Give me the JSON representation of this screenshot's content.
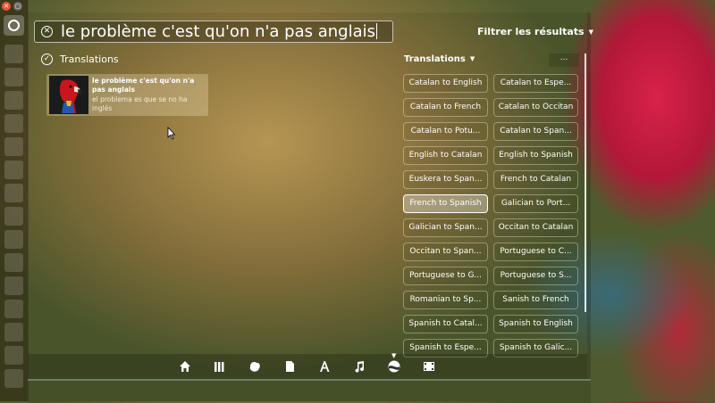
{
  "launcher": {
    "close_icon": "close-icon",
    "maximize_icon": "maximize-icon",
    "home_icon": "ubuntu-logo-icon",
    "items": [
      "app-item",
      "app-item",
      "app-item",
      "app-item",
      "app-item",
      "app-item",
      "app-item",
      "app-item",
      "app-item",
      "app-item",
      "app-item",
      "app-item",
      "app-item",
      "app-item",
      "app-item"
    ]
  },
  "search": {
    "query": "le problème c'est qu'on n'a pas anglais",
    "clear_icon": "clear-icon"
  },
  "filter_toggle": {
    "label": "Filtrer les résultats"
  },
  "results": {
    "category_label": "Translations",
    "category_icon": "check-circle-icon",
    "items": [
      {
        "title": "le problème c'est qu'on n'a pas anglais",
        "subtitle": "el problema es que se no ha inglés",
        "thumbnail": "parrot-icon"
      }
    ]
  },
  "filters": {
    "header": "Translations",
    "more_label": "...",
    "options": [
      {
        "label": "Catalan to English",
        "active": false
      },
      {
        "label": "Catalan to Espe...",
        "active": false
      },
      {
        "label": "Catalan to French",
        "active": false
      },
      {
        "label": "Catalan to Occitan",
        "active": false
      },
      {
        "label": "Catalan to Potu...",
        "active": false
      },
      {
        "label": "Catalan to Span...",
        "active": false
      },
      {
        "label": "English to Catalan",
        "active": false
      },
      {
        "label": "English to Spanish",
        "active": false
      },
      {
        "label": "Euskera to Span...",
        "active": false
      },
      {
        "label": "French to Catalan",
        "active": false
      },
      {
        "label": "French to Spanish",
        "active": true
      },
      {
        "label": "Galician to Port...",
        "active": false
      },
      {
        "label": "Galician to Span...",
        "active": false
      },
      {
        "label": "Occitan to Catalan",
        "active": false
      },
      {
        "label": "Occitan to Span...",
        "active": false
      },
      {
        "label": "Portuguese to C...",
        "active": false
      },
      {
        "label": "Portuguese to G...",
        "active": false
      },
      {
        "label": "Portuguese to S...",
        "active": false
      },
      {
        "label": "Romanian to Sp...",
        "active": false
      },
      {
        "label": "Sanish to French",
        "active": false
      },
      {
        "label": "Spanish to Catal...",
        "active": false
      },
      {
        "label": "Spanish to English",
        "active": false
      },
      {
        "label": "Spanish to Espe...",
        "active": false
      },
      {
        "label": "Spanish to Galic...",
        "active": false
      }
    ]
  },
  "lenses": [
    "home-lens-icon",
    "applications-lens-icon",
    "ubuntu-one-lens-icon",
    "files-lens-icon",
    "fonts-lens-icon",
    "music-lens-icon",
    "translation-lens-icon",
    "video-lens-icon"
  ],
  "active_lens": "translation-lens-icon"
}
